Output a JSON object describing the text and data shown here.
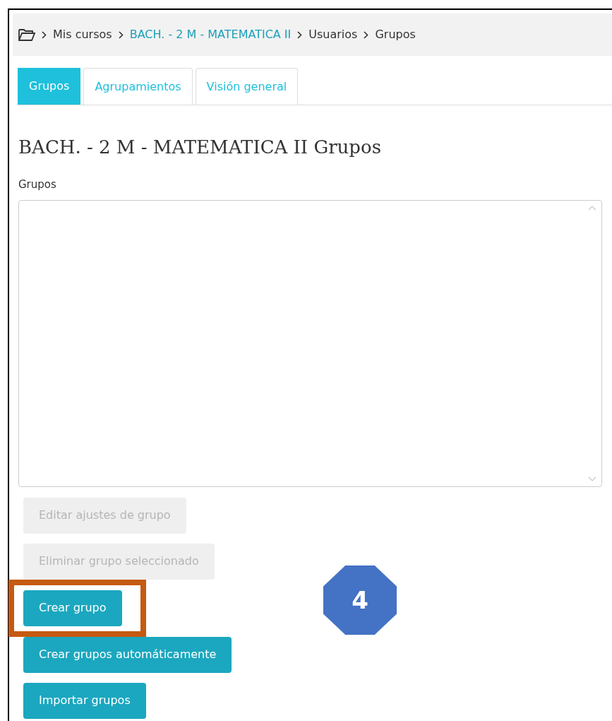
{
  "breadcrumb": [
    {
      "label": "Mis cursos",
      "link": false
    },
    {
      "label": "BACH. - 2 M - MATEMATICA II",
      "link": true
    },
    {
      "label": "Usuarios",
      "link": false
    },
    {
      "label": "Grupos",
      "link": false
    }
  ],
  "tabs": [
    {
      "label": "Grupos",
      "selected": true
    },
    {
      "label": "Agrupamientos",
      "selected": false
    },
    {
      "label": "Visión general",
      "selected": false
    }
  ],
  "heading": "BACH. - 2 M - MATEMATICA II Grupos",
  "groups_list": {
    "label": "Grupos"
  },
  "buttons": [
    {
      "label": "Editar ajustes de grupo",
      "disabled": true,
      "highlighted": false
    },
    {
      "label": "Eliminar grupo seleccionado",
      "disabled": true,
      "highlighted": false
    },
    {
      "label": "Crear grupo",
      "disabled": false,
      "highlighted": true
    },
    {
      "label": "Crear grupos automáticamente",
      "disabled": false,
      "highlighted": false
    },
    {
      "label": "Importar grupos",
      "disabled": false,
      "highlighted": false
    }
  ],
  "callout": {
    "label": "4"
  }
}
